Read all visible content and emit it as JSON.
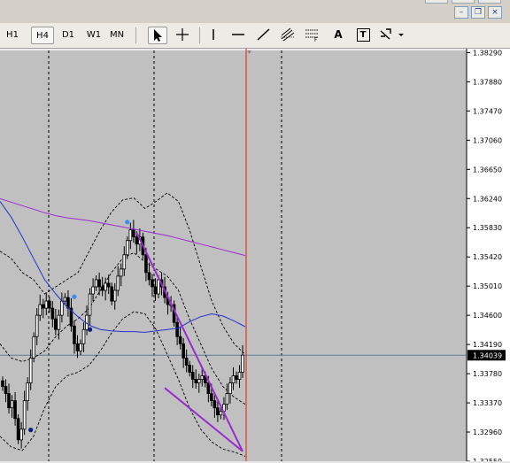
{
  "timeframes": [
    {
      "label": "H1",
      "active": false
    },
    {
      "label": "H4",
      "active": true
    },
    {
      "label": "D1",
      "active": false
    },
    {
      "label": "W1",
      "active": false
    },
    {
      "label": "MN",
      "active": false
    }
  ],
  "tools": [
    {
      "name": "cursor-tool",
      "active": true
    },
    {
      "name": "crosshair-tool",
      "active": false
    },
    {
      "name": "vertical-line-tool",
      "active": false
    },
    {
      "name": "horizontal-line-tool",
      "active": false
    },
    {
      "name": "trendline-tool",
      "active": false
    },
    {
      "name": "fibonacci-channel-tool",
      "active": false
    },
    {
      "name": "fibonacci-tool",
      "active": false
    },
    {
      "name": "text-tool",
      "label": "A",
      "active": false
    },
    {
      "name": "text-label-tool",
      "label": "T",
      "active": false
    },
    {
      "name": "arrows-tool",
      "active": false
    }
  ],
  "chart_data": {
    "type": "candlestick",
    "price_scale": [
      "1.38290",
      "1.37880",
      "1.37470",
      "1.37060",
      "1.36650",
      "1.36240",
      "1.35830",
      "1.35420",
      "1.35010",
      "1.34600",
      "1.34190",
      "1.33780",
      "1.33370",
      "1.32960",
      "1.32550"
    ],
    "price_range": [
      1.3255,
      1.3832
    ],
    "current_price": "1.34039",
    "colors": {
      "background": "#c0c0c0",
      "candles": "#000000",
      "ma_slow": "#9a2ccd",
      "ma_fast": "#2233cc",
      "bollinger": "#000000",
      "trendline": "#9a2ccd",
      "current_bar_marker": "#dd2200",
      "bid_line": "#5a7a9a"
    },
    "ma_slow": [
      1.3624,
      1.3619,
      1.3614,
      1.3609,
      1.3604,
      1.36,
      1.3597,
      1.3595,
      1.3593,
      1.359,
      1.3587,
      1.3584,
      1.3581,
      1.3578,
      1.3575,
      1.3572,
      1.3568,
      1.3564,
      1.356,
      1.3556,
      1.3552,
      1.3548,
      1.3544
    ],
    "ma_fast": [
      1.362,
      1.3598,
      1.357,
      1.354,
      1.351,
      1.349,
      1.3472,
      1.3458,
      1.3446,
      1.344,
      1.3438,
      1.3437,
      1.3437,
      1.3436,
      1.3438,
      1.344,
      1.3442,
      1.3451,
      1.3458,
      1.3462,
      1.3459,
      1.3452,
      1.3444
    ],
    "bb_upper": [
      1.355,
      1.354,
      1.352,
      1.351,
      1.349,
      1.35,
      1.351,
      1.352,
      1.355,
      1.358,
      1.3605,
      1.3622,
      1.3625,
      1.361,
      1.362,
      1.3632,
      1.362,
      1.358,
      1.353,
      1.348,
      1.3445,
      1.342,
      1.3405
    ],
    "bb_lower": [
      1.329,
      1.3275,
      1.327,
      1.329,
      1.333,
      1.336,
      1.3375,
      1.338,
      1.339,
      1.341,
      1.3435,
      1.3455,
      1.3465,
      1.3462,
      1.344,
      1.3405,
      1.337,
      1.333,
      1.33,
      1.3282,
      1.3272,
      1.3268,
      1.3262
    ],
    "bb_middle": [
      1.342,
      1.34,
      1.3395,
      1.34,
      1.341,
      1.343,
      1.3445,
      1.3455,
      1.347,
      1.3495,
      1.352,
      1.354,
      1.3548,
      1.3535,
      1.3525,
      1.3515,
      1.3495,
      1.3455,
      1.342,
      1.3385,
      1.336,
      1.3345,
      1.3335
    ],
    "closes": [
      1.336,
      1.335,
      1.333,
      1.334,
      1.3315,
      1.3285,
      1.33,
      1.334,
      1.3365,
      1.34,
      1.343,
      1.346,
      1.3475,
      1.347,
      1.348,
      1.347,
      1.3455,
      1.344,
      1.346,
      1.348,
      1.3485,
      1.347,
      1.3445,
      1.342,
      1.341,
      1.342,
      1.344,
      1.346,
      1.349,
      1.35,
      1.351,
      1.35,
      1.3495,
      1.3505,
      1.35,
      1.348,
      1.3495,
      1.3515,
      1.3525,
      1.3545,
      1.3565,
      1.358,
      1.357,
      1.356,
      1.357,
      1.3545,
      1.352,
      1.351,
      1.35,
      1.349,
      1.351,
      1.35,
      1.3485,
      1.3475,
      1.3475,
      1.345,
      1.343,
      1.342,
      1.34,
      1.339,
      1.338,
      1.337,
      1.3365,
      1.337,
      1.3375,
      1.3365,
      1.335,
      1.334,
      1.333,
      1.332,
      1.3325,
      1.3335,
      1.335,
      1.3365,
      1.3375,
      1.337,
      1.338,
      1.3404
    ],
    "fractal_up": [
      {
        "index": 40,
        "price": 1.3591
      },
      {
        "index": 23,
        "price": 1.3486
      }
    ],
    "fractal_down": [
      {
        "index": 28,
        "price": 1.344
      },
      {
        "index": 9,
        "price": 1.3299
      }
    ],
    "trendlines": [
      {
        "from": {
          "index": 43,
          "price": 1.3576
        },
        "to": {
          "index": 77,
          "price": 1.3269
        }
      },
      {
        "from": {
          "index": 52,
          "price": 1.3358
        },
        "to": {
          "index": 77,
          "price": 1.3269
        }
      }
    ]
  }
}
